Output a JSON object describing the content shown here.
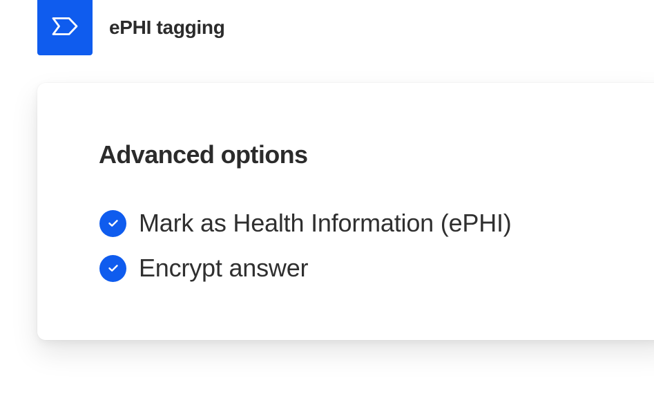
{
  "header": {
    "icon": "tag-icon",
    "title": "ePHI tagging"
  },
  "card": {
    "title": "Advanced options",
    "options": [
      {
        "label": "Mark as Health Information (ePHI)",
        "checked": true,
        "icon": "check-icon"
      },
      {
        "label": "Encrypt answer",
        "checked": true,
        "icon": "check-icon"
      }
    ]
  },
  "colors": {
    "accent": "#0f5cee",
    "text": "#2b2b2b",
    "background": "#ffffff"
  }
}
